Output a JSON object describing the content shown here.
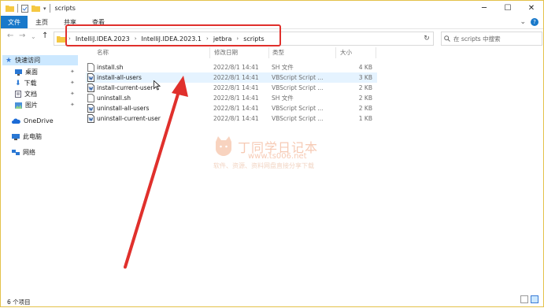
{
  "window": {
    "title": "scripts",
    "minimize": "─",
    "maximize": "☐",
    "close": "✕"
  },
  "ribbon": {
    "file": "文件",
    "home": "主页",
    "share": "共享",
    "view": "查看",
    "expand": "⌄",
    "help": "?"
  },
  "nav": {
    "back": "←",
    "forward": "→",
    "recent": "⌄",
    "up": "↑"
  },
  "address": {
    "crumbs": [
      "IntelliJ.IDEA.2023",
      "IntelliJ.IDEA.2023.1",
      "jetbra",
      "scripts"
    ],
    "refresh": "↻"
  },
  "search": {
    "placeholder": "在 scripts 中搜索"
  },
  "sidebar": {
    "quick_access": "快速访问",
    "items": [
      "桌面",
      "下载",
      "文档",
      "图片"
    ],
    "onedrive": "OneDrive",
    "this_pc": "此电脑",
    "network": "网络"
  },
  "columns": {
    "name": "名称",
    "date": "修改日期",
    "type": "类型",
    "size": "大小"
  },
  "files": [
    {
      "name": "install.sh",
      "date": "2022/8/1 14:41",
      "type": "SH 文件",
      "size": "4 KB",
      "icon": "blank-file-icon"
    },
    {
      "name": "install-all-users",
      "date": "2022/8/1 14:41",
      "type": "VBScript Script ...",
      "size": "3 KB",
      "icon": "vbscript-file-icon"
    },
    {
      "name": "install-current-user",
      "date": "2022/8/1 14:41",
      "type": "VBScript Script ...",
      "size": "2 KB",
      "icon": "vbscript-file-icon"
    },
    {
      "name": "uninstall.sh",
      "date": "2022/8/1 14:41",
      "type": "SH 文件",
      "size": "2 KB",
      "icon": "blank-file-icon"
    },
    {
      "name": "uninstall-all-users",
      "date": "2022/8/1 14:41",
      "type": "VBScript Script ...",
      "size": "2 KB",
      "icon": "vbscript-file-icon"
    },
    {
      "name": "uninstall-current-user",
      "date": "2022/8/1 14:41",
      "type": "VBScript Script ...",
      "size": "1 KB",
      "icon": "vbscript-file-icon"
    }
  ],
  "status": {
    "count": "6 个项目"
  },
  "watermark": {
    "title": "丁同学日记本",
    "url": "www.ts006.net",
    "slogan": "软件、资源、资料网盘直接分享下载"
  },
  "colors": {
    "accent": "#1979ca",
    "annotation_red": "#e0302c",
    "selection": "#cce8ff"
  }
}
